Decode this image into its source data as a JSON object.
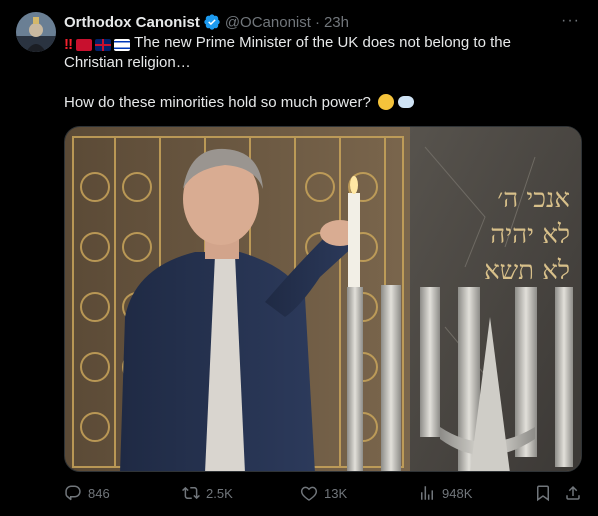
{
  "tweet": {
    "author_name": "Orthodox Canonist",
    "handle": "@OCanonist",
    "separator": "·",
    "time": "23h",
    "more_label": "···",
    "text_line1": "The new Prime Minister of the UK does not belong to the Christian religion…",
    "text_line2": "How do these minorities hold so much power?",
    "media_hebrew": [
      "אנכי ה׳",
      "לא יהיה",
      "לא תשא"
    ]
  },
  "actions": {
    "replies": "846",
    "reposts": "2.5K",
    "likes": "13K",
    "views": "948K"
  },
  "colors": {
    "background": "#000000",
    "text": "#e7e9ea",
    "muted": "#71767b",
    "verified": "#1d9bf0"
  },
  "icons": [
    "verified-badge-icon",
    "more-icon",
    "reply-icon",
    "repost-icon",
    "like-icon",
    "views-icon",
    "bookmark-icon",
    "share-icon"
  ]
}
